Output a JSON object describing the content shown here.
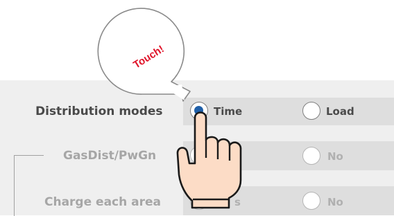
{
  "overlay": {
    "callout_text": "Touch!",
    "callout_color": "#e0142a"
  },
  "rows": [
    {
      "label": "Distribution modes",
      "state": "active",
      "options": [
        {
          "label": "Time",
          "checked": true
        },
        {
          "label": "Load",
          "checked": false
        }
      ]
    },
    {
      "label": "GasDist/PwGn",
      "state": "disabled",
      "options": [
        {
          "label": "",
          "checked": false
        },
        {
          "label": "No",
          "checked": false
        }
      ]
    },
    {
      "label": "Charge each area",
      "state": "disabled",
      "options": [
        {
          "label": "s",
          "checked": false
        },
        {
          "label": "No",
          "checked": false
        }
      ]
    }
  ],
  "colors": {
    "panel_bg": "#efefef",
    "row_bg": "#dedede",
    "radio_selected": "#1f5fa8"
  },
  "icons": [
    "pointing-hand-icon",
    "speech-bubble-icon"
  ]
}
